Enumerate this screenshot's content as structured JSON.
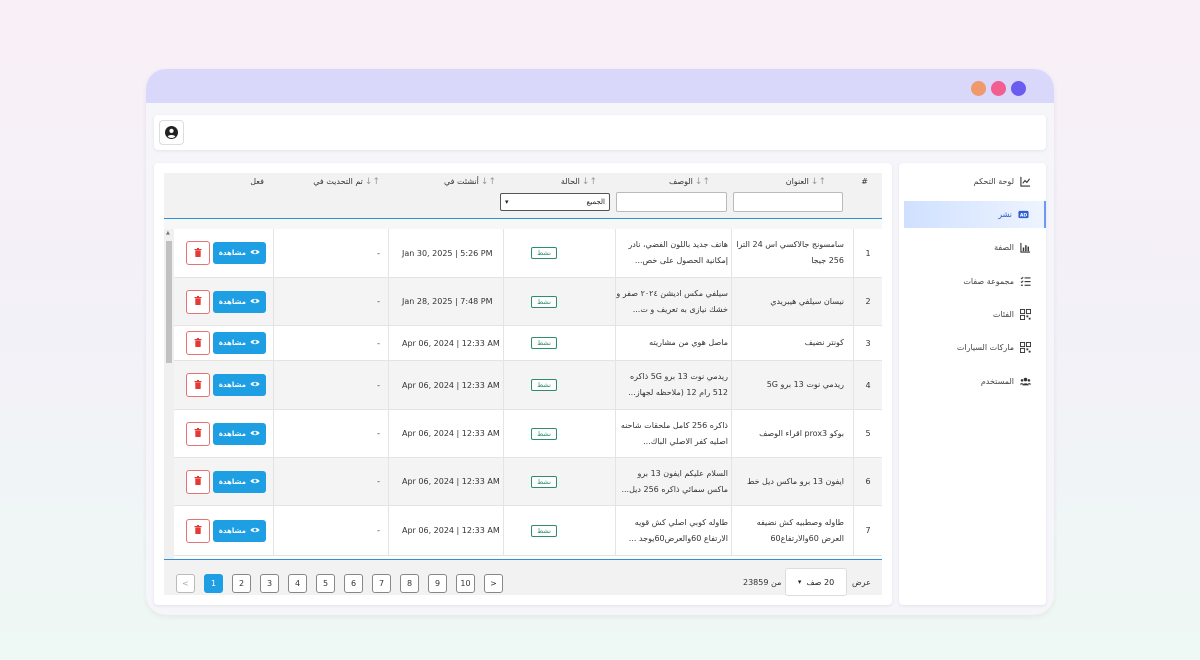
{
  "sidebar": {
    "items": [
      {
        "label": "لوحة التحكم",
        "icon": "chart-line-icon",
        "active": false
      },
      {
        "label": "نشر",
        "icon": "ad-icon",
        "active": true
      },
      {
        "label": "الصفة",
        "icon": "bar-chart-icon",
        "active": false
      },
      {
        "label": "مجموعة صفات",
        "icon": "list-check-icon",
        "active": false
      },
      {
        "label": "الفئات",
        "icon": "qrcode-icon",
        "active": false
      },
      {
        "label": "ماركات السيارات",
        "icon": "qrcode-icon",
        "active": false
      },
      {
        "label": "المستخدم",
        "icon": "users-icon",
        "active": false
      }
    ]
  },
  "table": {
    "headers": {
      "num": "#",
      "title": "العنوان",
      "description": "الوصف",
      "status": "الحالة",
      "created": "أنشئت في",
      "updated": "تم التحديث في",
      "action": "فعل"
    },
    "status_filter": "الجميع",
    "rows": [
      {
        "num": "1",
        "title": "سامسونج جالاكسي اس 24 الترا 256 جيجا",
        "description": "هاتف جديد باللون الفضي، نادر إمكانية الحصول على خص...",
        "status": "نشط",
        "created": "Jan 30, 2025 | 5:26 PM",
        "updated": "-"
      },
      {
        "num": "2",
        "title": "نيسان سيلفي هيبريدي",
        "description": "سيلفي مكس اديشن ٢٠٢٤ صفر و خشك نيازى به تعريف و ت...",
        "status": "نشط",
        "created": "Jan 28, 2025 | 7:48 PM",
        "updated": "-"
      },
      {
        "num": "3",
        "title": "كونتر نضيف",
        "description": "ماصل هوي من مشاريته",
        "status": "نشط",
        "created": "Apr 06, 2024 | 12:33 AM",
        "updated": "-"
      },
      {
        "num": "4",
        "title": "ريدمي نوت 13 برو 5G",
        "description": "ريدمي نوت 13 برو 5G ذاكره 512 رام 12 (ملاحظه لجهاز...",
        "status": "نشط",
        "created": "Apr 06, 2024 | 12:33 AM",
        "updated": "-"
      },
      {
        "num": "5",
        "title": "بوكو prox3 اقراء الوصف",
        "description": "ذاكره 256 كامل ملحقات شاحنه اصليه كفر الاصلي الباك...",
        "status": "نشط",
        "created": "Apr 06, 2024 | 12:33 AM",
        "updated": "-"
      },
      {
        "num": "6",
        "title": "ايفون 13 برو ماكس ديل خط",
        "description": "السلام عليكم ايفون 13 برو ماكس سمائي ذاكره 256 ديل...",
        "status": "نشط",
        "created": "Apr 06, 2024 | 12:33 AM",
        "updated": "-"
      },
      {
        "num": "7",
        "title": "طاوله وصطبيه كش نضيفه العرض 60والارتفاع60",
        "description": "طاوله كوبي اصلي كش قويه الارتفاع 60والعرض60يوجد ...",
        "status": "نشط",
        "created": "Apr 06, 2024 | 12:33 AM",
        "updated": "-"
      }
    ],
    "view_label": "مشاهدة"
  },
  "footer": {
    "show_label": "عرض",
    "per_page": "20 صف",
    "of_label": "من",
    "total": "23859",
    "pages": [
      "1",
      "2",
      "3",
      "4",
      "5",
      "6",
      "7",
      "8",
      "9",
      "10"
    ],
    "current_page": "1",
    "prev": "<",
    "next": ">"
  },
  "colors": {
    "accent": "#1e9fe4",
    "status": "#2e8d6a",
    "danger": "#e53935",
    "titlebar": "#d9d8fb"
  }
}
